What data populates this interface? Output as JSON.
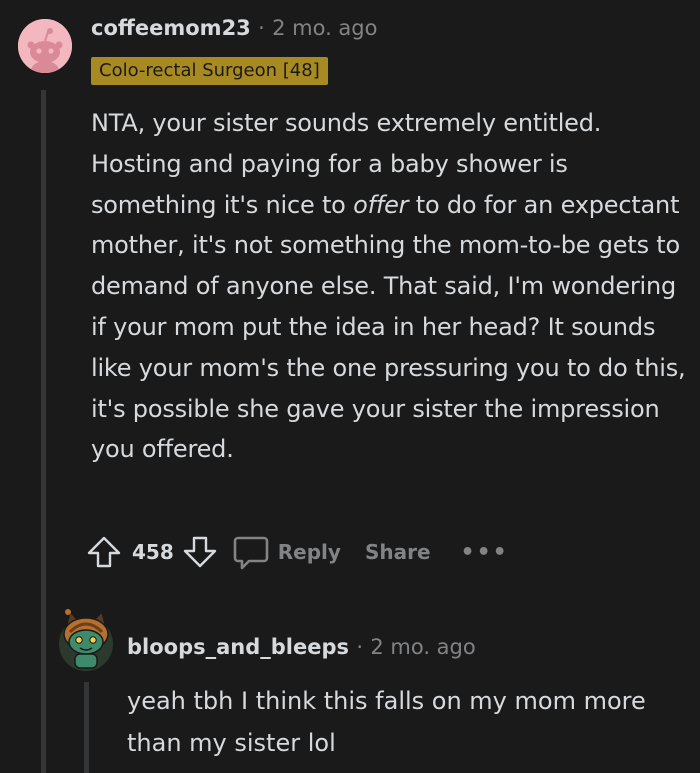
{
  "comment": {
    "username": "coffeemom23",
    "separator": "·",
    "time": "2 mo. ago",
    "flair": "Colo-rectal Surgeon [48]",
    "body_before_emphasis": "NTA, your sister sounds extremely entitled. Hosting and paying for a baby shower is something it's nice to ",
    "body_emphasis": "offer",
    "body_after_emphasis": " to do for an expectant mother, it's not something the mom-to-be gets to demand of anyone else. That said, I'm wondering if your mom put the idea in her head? It sounds like your mom's the one pressuring you to do this, it's possible she gave your sister the impression you offered.",
    "score": "458",
    "reply_label": "Reply",
    "share_label": "Share",
    "more_label": "•••"
  },
  "reply": {
    "username": "bloops_and_bleeps",
    "separator": "·",
    "time": "2 mo. ago",
    "body": "yeah tbh I think this falls on my mom more than my sister lol"
  },
  "icons": {
    "upvote": "upvote-arrow-icon",
    "downvote": "downvote-arrow-icon",
    "reply": "speech-bubble-icon",
    "more": "more-dots-icon"
  },
  "colors": {
    "background": "#1a1a1b",
    "text": "#d7dadc",
    "meta": "#818384",
    "flair_bg": "#a88a23",
    "thread_line": "#343536",
    "avatar1_bg": "#f3b7c0"
  }
}
